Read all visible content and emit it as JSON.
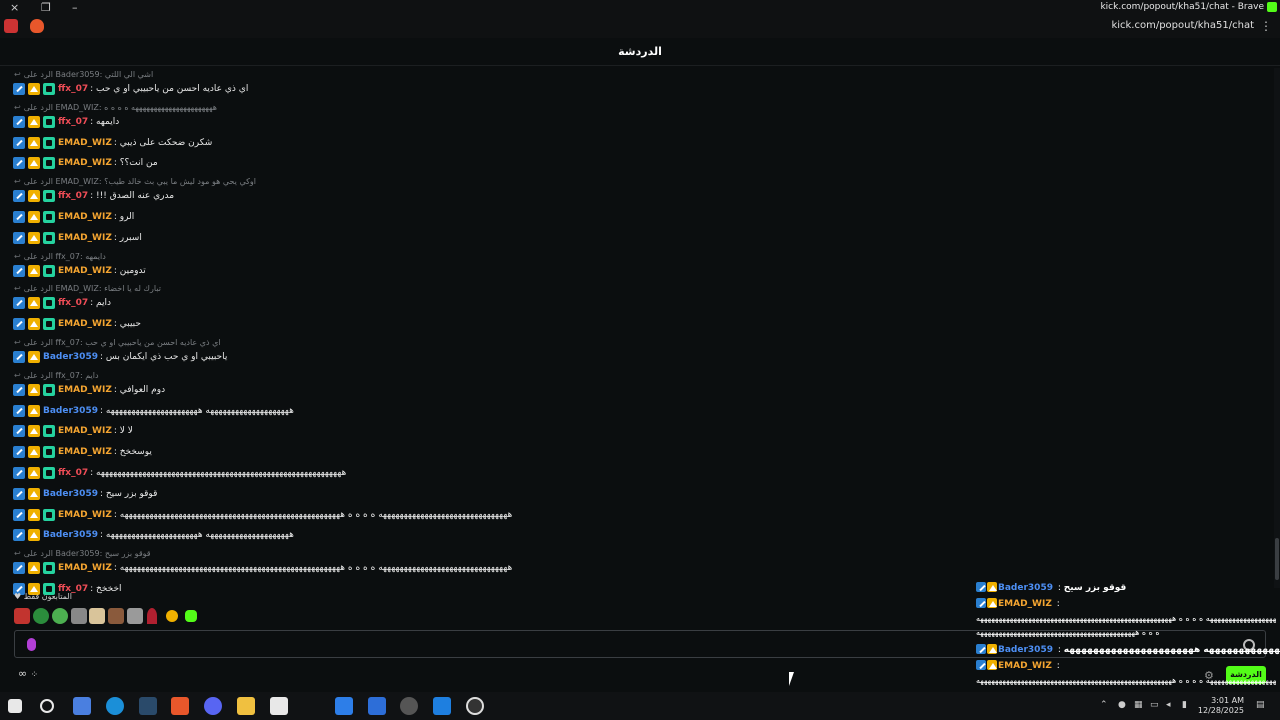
{
  "window": {
    "title": "kick.com/popout/kha51/chat - Brave",
    "url": "kick.com/popout/kha51/chat",
    "close_icon": "×",
    "restore_icon": "❐",
    "minimize_icon": "–"
  },
  "chat": {
    "header": "الدردشة",
    "colors": {
      "red": "#f04d57",
      "orange": "#f4a531",
      "blue": "#4d8ff4",
      "green": "#53fc18"
    },
    "messages": [
      {
        "reply": "الرد على Bader3059: اشي الي اللتي",
        "badges": [
          "mod",
          "vip",
          "sub"
        ],
        "user": "ffx_07",
        "color": "#f04d57",
        "text": "اي ذي عاديه احسن من ياحبيبي او ي حب"
      },
      {
        "reply": "الرد على EMAD_WIZ: ههههههههههههههههههههههه ه ه ه ه",
        "badges": [
          "mod",
          "vip",
          "sub"
        ],
        "user": "ffx_07",
        "color": "#f04d57",
        "text": "دايمهه"
      },
      {
        "reply": "",
        "badges": [
          "mod",
          "vip",
          "sub"
        ],
        "user": "EMAD_WIZ",
        "color": "#f4a531",
        "text": "شكرن ضحكت على ذيبي"
      },
      {
        "reply": "",
        "badges": [
          "mod",
          "vip",
          "sub"
        ],
        "user": "EMAD_WIZ",
        "color": "#f4a531",
        "text": "من انت؟؟"
      },
      {
        "reply": "الرد على EMAD_WIZ: اوكي يحي هو مود ليش ما يبي بث خالد طيب؟",
        "badges": [
          "mod",
          "vip",
          "sub"
        ],
        "user": "ffx_07",
        "color": "#f04d57",
        "text": "!!! مدري عنه الصدق"
      },
      {
        "reply": "",
        "badges": [
          "mod",
          "vip",
          "sub"
        ],
        "user": "EMAD_WIZ",
        "color": "#f4a531",
        "text": "الرو"
      },
      {
        "reply": "",
        "badges": [
          "mod",
          "vip",
          "sub"
        ],
        "user": "EMAD_WIZ",
        "color": "#f4a531",
        "text": "اسبرر"
      },
      {
        "reply": "الرد على ffx_07: دايمهه",
        "badges": [
          "mod",
          "vip",
          "sub"
        ],
        "user": "EMAD_WIZ",
        "color": "#f4a531",
        "text": "تدومين"
      },
      {
        "reply": "الرد على EMAD_WIZ: تبارك له يا اخضاء",
        "badges": [
          "mod",
          "vip",
          "sub"
        ],
        "user": "ffx_07",
        "color": "#f04d57",
        "text": "دايم"
      },
      {
        "reply": "",
        "badges": [
          "mod",
          "vip",
          "sub"
        ],
        "user": "EMAD_WIZ",
        "color": "#f4a531",
        "text": "حبيبي"
      },
      {
        "reply": "الرد على ffx_07: اي ذي عاديه احسن من ياحبيبي او ي حب",
        "badges": [
          "mod",
          "vip"
        ],
        "user": "Bader3059",
        "color": "#4d8ff4",
        "text": "ياحبيبي او ي حب ذي ايكمان بس"
      },
      {
        "reply": "الرد على ffx_07: دايم",
        "badges": [
          "mod",
          "vip",
          "sub"
        ],
        "user": "EMAD_WIZ",
        "color": "#f4a531",
        "text": "دوم العوافي"
      },
      {
        "reply": "",
        "badges": [
          "mod",
          "vip"
        ],
        "user": "Bader3059",
        "color": "#4d8ff4",
        "text": "ههههههههههههههههههههه ههههههههههههههههههههههه"
      },
      {
        "reply": "",
        "badges": [
          "mod",
          "vip",
          "sub"
        ],
        "user": "EMAD_WIZ",
        "color": "#f4a531",
        "text": "لا لا"
      },
      {
        "reply": "",
        "badges": [
          "mod",
          "vip",
          "sub"
        ],
        "user": "EMAD_WIZ",
        "color": "#f4a531",
        "text": "يوسخخخ"
      },
      {
        "reply": "",
        "badges": [
          "mod",
          "vip",
          "sub"
        ],
        "user": "ffx_07",
        "color": "#f04d57",
        "text": "هههههههههههههههههههههههههههههههههههههههههههههههههههههههههههه"
      },
      {
        "reply": "",
        "badges": [
          "mod",
          "vip"
        ],
        "user": "Bader3059",
        "color": "#4d8ff4",
        "text": "قوقو بزر سيح"
      },
      {
        "reply": "",
        "badges": [
          "mod",
          "vip",
          "sub"
        ],
        "user": "EMAD_WIZ",
        "color": "#f4a531",
        "text": "هههههههههههههههههههههههههههههههه ه ه ه ه هههههههههههههههههههههههههههههههههههههههههههههههههههههه"
      },
      {
        "reply": "",
        "badges": [
          "mod",
          "vip"
        ],
        "user": "Bader3059",
        "color": "#4d8ff4",
        "text": "ههههههههههههههههههههه ههههههههههههههههههههههه"
      },
      {
        "reply": "الرد على Bader3059: قوقو بزر سيح",
        "badges": [
          "mod",
          "vip",
          "sub"
        ],
        "user": "EMAD_WIZ",
        "color": "#f4a531",
        "text": "هههههههههههههههههههههههههههههههه ه ه ه ه هههههههههههههههههههههههههههههههههههههههههههههههههههههه"
      },
      {
        "reply": "",
        "badges": [
          "mod",
          "vip",
          "sub"
        ],
        "user": "ffx_07",
        "color": "#f04d57",
        "text": "اخخخخ"
      }
    ],
    "followers_label": "المتابعون فقط",
    "bottom_icon": "∞",
    "send_label": "الدردشة",
    "settings_icon": "⚙"
  },
  "overlay": {
    "messages": [
      {
        "user": "Bader3059",
        "color": "#4d8ff4",
        "text": "قوقو بزر سيح"
      },
      {
        "user": "EMAD_WIZ",
        "color": "#f4a531",
        "text": ""
      },
      {
        "long1": "هههههههههههههههههههههههههههههههه ه ه ه ه هههههههههههههههههههههههههههههههههههههههههههههههههههههه"
      },
      {
        "long1": "ه ه ه هههههههههههههههههههههههههههههههههههههههههههه"
      },
      {
        "user": "Bader3059",
        "color": "#4d8ff4",
        "text": "ههههههههههههههههههههه ههههههههههههههههههههههه"
      },
      {
        "user": "EMAD_WIZ",
        "color": "#f4a531",
        "text": ""
      },
      {
        "long1": "هههههههههههههههههههههههههههههههه ه ه ه ه هههههههههههههههههههههههههههههههههههههههههههههههههههههه"
      },
      {
        "long1": "ه ه ه هههههههههههههههههههههههههههههههههههههههههههه"
      },
      {
        "user": "ffx_07",
        "color": "#f04d57",
        "text": "اخخخخ"
      }
    ]
  },
  "taskbar": {
    "time": "3:01 AM",
    "date": "12/28/2025",
    "apps": [
      "start-icon",
      "search-icon",
      "copilot-icon",
      "edge-icon",
      "steam-icon",
      "brave-icon",
      "discord-icon",
      "file-explorer-icon",
      "store-icon",
      "mail-icon",
      "kick-app-icon",
      "settings-icon",
      "media-icon",
      "obs-icon"
    ]
  }
}
